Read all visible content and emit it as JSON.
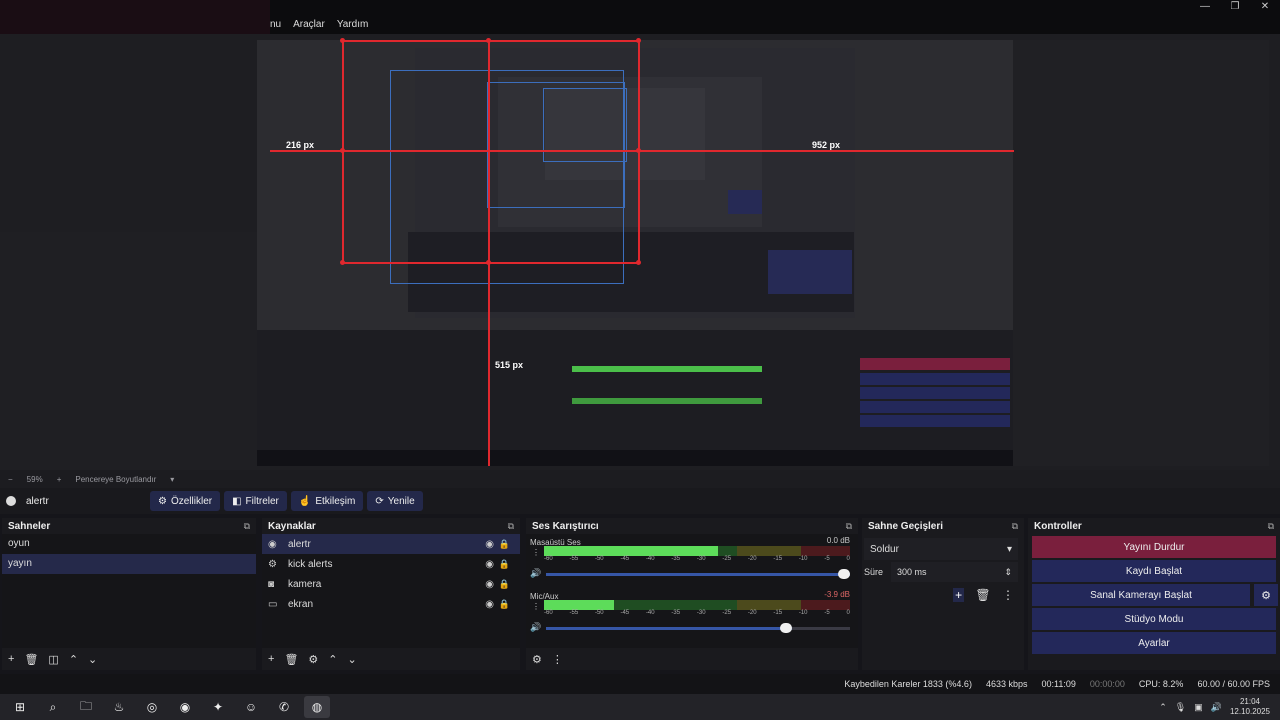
{
  "menu": {
    "items": [
      "nu",
      "Araçlar",
      "Yardım"
    ]
  },
  "window_controls": [
    "—",
    "❐",
    "✕"
  ],
  "preview": {
    "label_left": "216 px",
    "label_right": "952 px",
    "label_mid": "515 px"
  },
  "zoombar": {
    "minus": "−",
    "zoom": "59%",
    "plus": "+",
    "fit_label": "Pencereye Boyutlandır",
    "caret": "▾"
  },
  "source_toolbar": {
    "current_source": "alertr",
    "buttons": [
      {
        "icon": "⚙",
        "label": "Özellikler"
      },
      {
        "icon": "◧",
        "label": "Filtreler"
      },
      {
        "icon": "☝",
        "label": "Etkileşim"
      },
      {
        "icon": "⟳",
        "label": "Yenile"
      }
    ]
  },
  "scenes": {
    "title": "Sahneler",
    "items": [
      "oyun",
      "yayın"
    ],
    "selected": 1,
    "footer": [
      "+",
      "🗑",
      "◫",
      "⌃",
      "⌄"
    ]
  },
  "sources": {
    "title": "Kaynaklar",
    "items": [
      {
        "icon": "◉",
        "label": "alertr"
      },
      {
        "icon": "⚙",
        "label": "kick alerts"
      },
      {
        "icon": "◙",
        "label": "kamera"
      },
      {
        "icon": "▭",
        "label": "ekran"
      }
    ],
    "footer": [
      "+",
      "🗑",
      "⚙",
      "⌃",
      "⌄"
    ]
  },
  "mixer": {
    "title": "Ses Karıştırıcı",
    "ticks": [
      "-60",
      "-55",
      "-50",
      "-45",
      "-40",
      "-35",
      "-30",
      "-25",
      "-20",
      "-15",
      "-10",
      "-5",
      "0"
    ],
    "channels": [
      {
        "name": "Masaüstü Ses",
        "db": "0.0 dB",
        "db_color": "#c8c8c8",
        "level": 0.57,
        "volume": 1.0
      },
      {
        "name": "Mic/Aux",
        "db": "-3.9 dB",
        "db_color": "#d66",
        "level": 0.23,
        "volume": 0.81
      }
    ],
    "footer": [
      "⚙",
      "⋮"
    ]
  },
  "transitions": {
    "title": "Sahne Geçişleri",
    "selected": "Soldur",
    "duration_label": "Süre",
    "duration": "300 ms",
    "icons": [
      "+",
      "🗑",
      "⋮"
    ]
  },
  "controls": {
    "title": "Kontroller",
    "buttons": [
      {
        "label": "Yayını Durdur",
        "kind": "stop"
      },
      {
        "label": "Kaydı Başlat",
        "kind": "blue"
      },
      {
        "label": "Sanal Kamerayı Başlat",
        "kind": "blue"
      },
      {
        "label": "Stüdyo Modu",
        "kind": "blue"
      },
      {
        "label": "Ayarlar",
        "kind": "blue"
      }
    ]
  },
  "status": {
    "dropped": "Kaybedilen Kareler 1833 (%4.6)",
    "bitrate": "4633 kbps",
    "stream_time": "00:11:09",
    "rec_time": "00:00:00",
    "cpu": "CPU: 8.2%",
    "fps": "60.00 / 60.00 FPS"
  },
  "taskbar": {
    "icons": [
      "⊞",
      "⌕",
      "🗀",
      "♨",
      "◎",
      "◉",
      "✦",
      "☺",
      "✆",
      "◍"
    ],
    "active_index": 9,
    "tray": [
      "⌃",
      "🎙",
      "▣",
      "🔊"
    ],
    "time": "21:04",
    "date": "12.10.2025"
  },
  "colors": {
    "accent": "#23285a",
    "stop": "#7a1f3d",
    "measure": "#e0282e"
  }
}
